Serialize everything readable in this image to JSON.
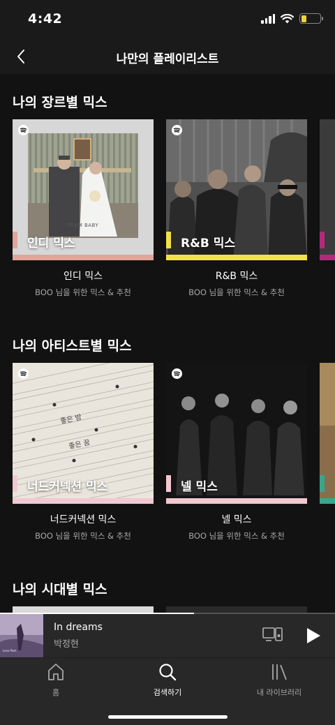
{
  "status_bar": {
    "time": "4:42",
    "battery_level": 0.3
  },
  "header": {
    "title": "나만의 플레이리스트"
  },
  "sections": [
    {
      "title": "나의 장르별 믹스",
      "cards": [
        {
          "cover_label": "인디 믹스",
          "cover_caption": "TEAM BABY",
          "title": "인디 믹스",
          "subtitle": "BOO 님을 위한 믹스 & 추천",
          "accent": "#e1a59a"
        },
        {
          "cover_label": "R&B 믹스",
          "title": "R&B 믹스",
          "subtitle": "BOO 님을 위한 믹스 & 추천",
          "accent": "#f3e14a"
        }
      ],
      "peek_accent": "#b4287c"
    },
    {
      "title": "나의 아티스트별 믹스",
      "cards": [
        {
          "cover_label": "너드커넥션 믹스",
          "cover_caption": "좋은 밤",
          "cover_caption2": "좋은 꿈",
          "title": "너드커넥션 믹스",
          "subtitle": "BOO 님을 위한 믹스 & 추천",
          "accent": "#f2c8d2"
        },
        {
          "cover_label": "넬 믹스",
          "title": "넬 믹스",
          "subtitle": "BOO 님을 위한 믹스 & 추천",
          "accent": "#f2c8d2"
        }
      ],
      "peek_accent": "#3aa58c"
    },
    {
      "title": "나의 시대별 믹스"
    }
  ],
  "now_playing": {
    "song": "In dreams",
    "artist": "박정현",
    "progress": 0.58,
    "art_caption": "Lena Park"
  },
  "tabs": [
    {
      "label": "홈",
      "icon": "home-icon"
    },
    {
      "label": "검색하기",
      "icon": "search-icon",
      "active": true
    },
    {
      "label": "내 라이브러리",
      "icon": "library-icon"
    }
  ]
}
